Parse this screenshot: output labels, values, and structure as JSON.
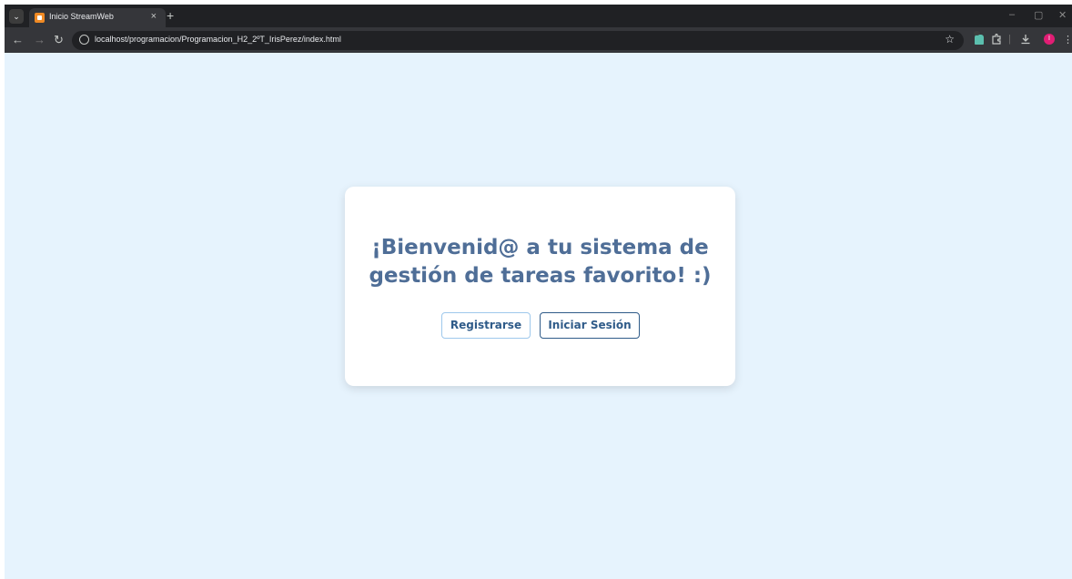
{
  "browser": {
    "tab": {
      "title": "Inicio StreamWeb",
      "close": "×"
    },
    "new_tab": "+",
    "window_controls": {
      "minimize": "–",
      "restore": "▢",
      "close": "✕"
    },
    "nav": {
      "back": "←",
      "forward": "→",
      "reload": "↻"
    },
    "url": "localhost/programacion/Programacion_H2_2ºT_IrisPerez/index.html",
    "bookmark_star": "☆",
    "profile_initial": "I",
    "icons": [
      "tab-search-icon",
      "site-info-icon",
      "extension-icon",
      "extensions-puzzle-icon",
      "download-icon",
      "profile-avatar",
      "menu-kebab-icon"
    ]
  },
  "page": {
    "heading": "¡Bienvenid@ a tu sistema de gestión de tareas favorito! :)",
    "register_label": "Registrarse",
    "login_label": "Iniciar Sesión"
  },
  "colors": {
    "page_bg": "#e6f3fd",
    "heading": "#4f6e97",
    "button_text": "#2f5b89",
    "register_border": "#9ec8ec",
    "login_border": "#2f5b89"
  }
}
